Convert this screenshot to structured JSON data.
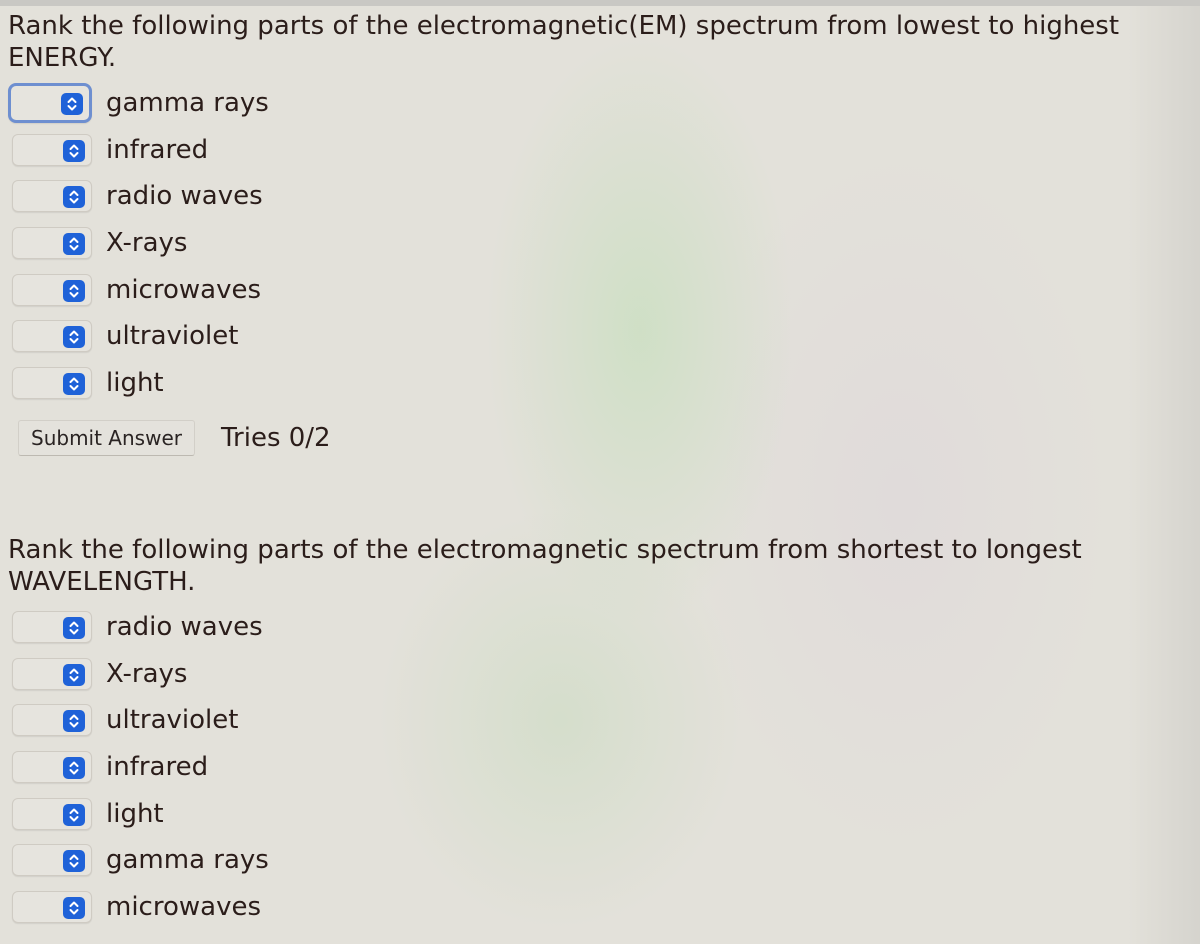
{
  "questions": [
    {
      "prompt": "Rank the following parts of the electromagnetic(EM) spectrum from lowest to highest ENERGY.",
      "items": [
        {
          "label": "gamma rays",
          "selected_rank": ""
        },
        {
          "label": "infrared",
          "selected_rank": ""
        },
        {
          "label": "radio waves",
          "selected_rank": ""
        },
        {
          "label": "X-rays",
          "selected_rank": ""
        },
        {
          "label": "microwaves",
          "selected_rank": ""
        },
        {
          "label": "ultraviolet",
          "selected_rank": ""
        },
        {
          "label": "light",
          "selected_rank": ""
        }
      ],
      "focused_item_index": 0,
      "submit_label": "Submit Answer",
      "tries_label": "Tries 0/2"
    },
    {
      "prompt": "Rank the following parts of the electromagnetic spectrum from shortest to longest WAVELENGTH.",
      "items": [
        {
          "label": "radio waves",
          "selected_rank": ""
        },
        {
          "label": "X-rays",
          "selected_rank": ""
        },
        {
          "label": "ultraviolet",
          "selected_rank": ""
        },
        {
          "label": "infrared",
          "selected_rank": ""
        },
        {
          "label": "light",
          "selected_rank": ""
        },
        {
          "label": "gamma rays",
          "selected_rank": ""
        },
        {
          "label": "microwaves",
          "selected_rank": ""
        }
      ]
    }
  ],
  "icons": {
    "stepper": "up-down-chevron-icon"
  },
  "colors": {
    "stepper_blue": "#1f62d8",
    "focus_ring": "#6e8fd0",
    "text": "#2b1d1a",
    "background": "#e3e1da"
  }
}
